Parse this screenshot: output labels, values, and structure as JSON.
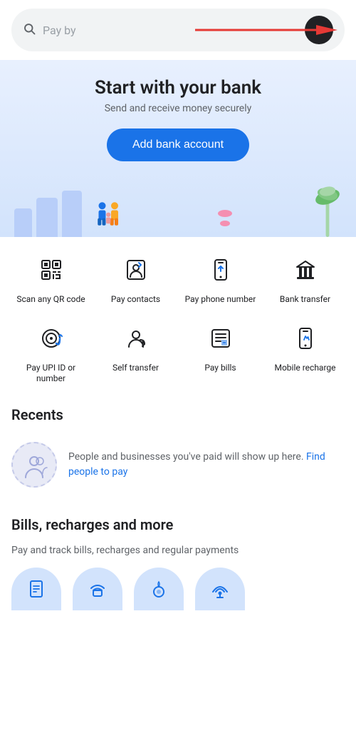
{
  "search": {
    "placeholder": "Pay by",
    "aria": "Search input"
  },
  "hero": {
    "title": "Start with your bank",
    "subtitle": "Send and receive money securely",
    "cta_label": "Add bank account"
  },
  "quick_actions": [
    {
      "id": "scan-qr",
      "label": "Scan any QR code",
      "icon": "qr"
    },
    {
      "id": "pay-contacts",
      "label": "Pay contacts",
      "icon": "contacts"
    },
    {
      "id": "pay-phone",
      "label": "Pay phone number",
      "icon": "phone"
    },
    {
      "id": "bank-transfer",
      "label": "Bank transfer",
      "icon": "bank"
    },
    {
      "id": "pay-upi",
      "label": "Pay UPI ID or number",
      "icon": "upi"
    },
    {
      "id": "self-transfer",
      "label": "Self transfer",
      "icon": "self"
    },
    {
      "id": "pay-bills",
      "label": "Pay bills",
      "icon": "bills"
    },
    {
      "id": "mobile-recharge",
      "label": "Mobile recharge",
      "icon": "mobile"
    }
  ],
  "recents": {
    "section_title": "Recents",
    "placeholder_text": "People and businesses you've paid will show up here. ",
    "link_text": "Find people to pay"
  },
  "bills_section": {
    "section_title": "Bills, recharges and more",
    "subtitle": "Pay and track bills, recharges and regular payments",
    "icons": [
      {
        "id": "electricity",
        "icon": "electricity"
      },
      {
        "id": "broadband",
        "icon": "broadband"
      },
      {
        "id": "gas",
        "icon": "gas"
      },
      {
        "id": "dth",
        "icon": "dth"
      }
    ]
  },
  "colors": {
    "primary": "#1a73e8",
    "text_dark": "#202124",
    "text_medium": "#5f6368",
    "text_light": "#9aa0a6",
    "bg_hero": "#e8f0fe",
    "bg_icon": "#d2e3fc"
  }
}
